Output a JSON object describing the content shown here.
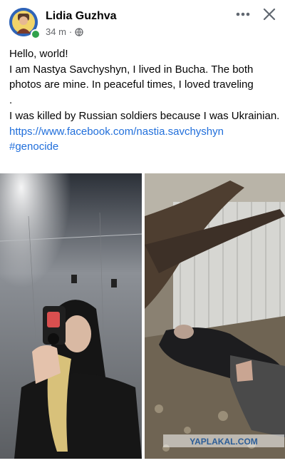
{
  "post": {
    "author": "Lidia Guzhva",
    "time": "34 m",
    "separator": "·",
    "privacy_icon": "globe-icon",
    "more_icon": "more-horizontal-icon",
    "close_icon": "close-icon",
    "text_lines": [
      "Hello, world!",
      "I am Nastya Savchyshyn, I lived in Bucha. The both photos are mine. In peaceful times, I loved traveling",
      ".",
      "I was killed by Russian soldiers because I was Ukrainian."
    ],
    "link_url": "https://www.facebook.com/nastia.savchyshyn",
    "hashtag": "#genocide"
  },
  "photos": {
    "watermark": "YAPLAKAL.COM"
  },
  "colors": {
    "link": "#216fdb",
    "online": "#31a24c",
    "meta_text": "#65676b"
  }
}
